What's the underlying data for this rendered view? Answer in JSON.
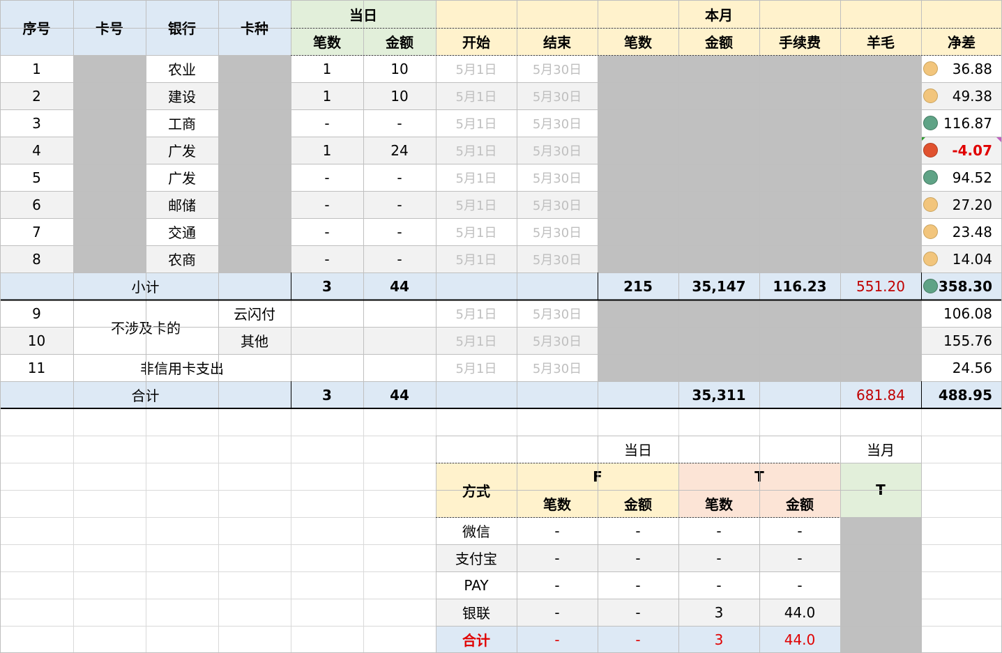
{
  "colors": {
    "header_blue": "#dde9f5",
    "header_green": "#e2efda",
    "header_yellow": "#fff2cc",
    "header_peach": "#fce4d6",
    "masked_gray": "#c0c0c0",
    "negative_red": "#e00000",
    "wool_red": "#c00000"
  },
  "headers": {
    "seq": "序号",
    "card_no": "卡号",
    "bank": "银行",
    "card_type": "卡种",
    "today": "当日",
    "month": "本月",
    "count": "笔数",
    "amount": "金额",
    "start": "开始",
    "end": "结束",
    "fee": "手续费",
    "wool": "羊毛",
    "net": "净差"
  },
  "rows": [
    {
      "seq": "1",
      "bank": "农业",
      "count": "1",
      "amount": "10",
      "start": "5月1日",
      "end": "5月30日",
      "net": "36.88",
      "indicator": "yellow-circle-icon"
    },
    {
      "seq": "2",
      "bank": "建设",
      "count": "1",
      "amount": "10",
      "start": "5月1日",
      "end": "5月30日",
      "net": "49.38",
      "indicator": "yellow-circle-icon"
    },
    {
      "seq": "3",
      "bank": "工商",
      "count": "-",
      "amount": "-",
      "start": "5月1日",
      "end": "5月30日",
      "net": "116.87",
      "indicator": "green-circle-icon"
    },
    {
      "seq": "4",
      "bank": "广发",
      "count": "1",
      "amount": "24",
      "start": "5月1日",
      "end": "5月30日",
      "net": "-4.07",
      "indicator": "red-circle-icon"
    },
    {
      "seq": "5",
      "bank": "广发",
      "count": "-",
      "amount": "-",
      "start": "5月1日",
      "end": "5月30日",
      "net": "94.52",
      "indicator": "green-circle-icon"
    },
    {
      "seq": "6",
      "bank": "邮储",
      "count": "-",
      "amount": "-",
      "start": "5月1日",
      "end": "5月30日",
      "net": "27.20",
      "indicator": "yellow-circle-icon"
    },
    {
      "seq": "7",
      "bank": "交通",
      "count": "-",
      "amount": "-",
      "start": "5月1日",
      "end": "5月30日",
      "net": "23.48",
      "indicator": "yellow-circle-icon"
    },
    {
      "seq": "8",
      "bank": "农商",
      "count": "-",
      "amount": "-",
      "start": "5月1日",
      "end": "5月30日",
      "net": "14.04",
      "indicator": "yellow-circle-icon"
    }
  ],
  "subtotal": {
    "label": "小计",
    "today_count": "3",
    "today_amount": "44",
    "month_count": "215",
    "month_amount": "35,147",
    "fee": "116.23",
    "wool": "551.20",
    "net": "358.30",
    "indicator": "green-circle-icon"
  },
  "other_rows": {
    "group_label": "不涉及卡的",
    "r9": {
      "seq": "9",
      "type": "云闪付",
      "start": "5月1日",
      "end": "5月30日",
      "net": "106.08"
    },
    "r10": {
      "seq": "10",
      "type": "其他",
      "start": "5月1日",
      "end": "5月30日",
      "net": "155.76"
    },
    "r11": {
      "seq": "11",
      "label": "非信用卡支出",
      "start": "5月1日",
      "end": "5月30日",
      "net": "24.56"
    }
  },
  "total": {
    "label": "合计",
    "today_count": "3",
    "today_amount": "44",
    "month_amount": "35,311",
    "wool": "681.84",
    "net": "488.95"
  },
  "summary": {
    "today": "当日",
    "month": "当月",
    "method": "方式",
    "f": "F",
    "t": "T",
    "month_t": "T",
    "count": "笔数",
    "amount": "金额",
    "rows": [
      {
        "method": "微信",
        "f_count": "-",
        "f_amount": "-",
        "t_count": "-",
        "t_amount": "-"
      },
      {
        "method": "支付宝",
        "f_count": "-",
        "f_amount": "-",
        "t_count": "-",
        "t_amount": "-"
      },
      {
        "method": "PAY",
        "f_count": "-",
        "f_amount": "-",
        "t_count": "-",
        "t_amount": "-"
      },
      {
        "method": "银联",
        "f_count": "-",
        "f_amount": "-",
        "t_count": "3",
        "t_amount": "44.0"
      }
    ],
    "total": {
      "method": "合计",
      "f_count": "-",
      "f_amount": "-",
      "t_count": "3",
      "t_amount": "44.0"
    }
  }
}
